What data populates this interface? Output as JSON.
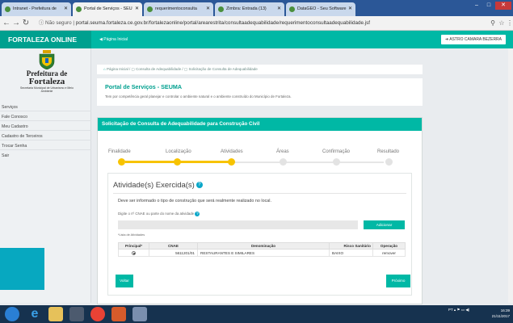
{
  "browser": {
    "tabs": [
      {
        "label": "Intranet - Prefeitura de"
      },
      {
        "label": "Portal de Serviços - SEU"
      },
      {
        "label": "requerimentoconsulta"
      },
      {
        "label": "Zimbra: Entrada (13)"
      },
      {
        "label": "DataGEO - Seu Software"
      }
    ],
    "url_security": "Não seguro",
    "url": "portal.seuma.fortaleza.ce.gov.br/fortalezaonline/portal/arearestrita/consultaadequabilidade/requerimentoconsultaadequabilidade.jsf"
  },
  "header": {
    "brand": "FORTALEZA ONLINE",
    "breadcrumb": "Página Inicial",
    "user_button": "ASTRO CAMARA BEZERRA"
  },
  "sidebar": {
    "logo": {
      "line1": "Prefeitura de",
      "line2": "Fortaleza",
      "line3": "Secretaria Municipal de Urbanismo e Meio Ambiente"
    },
    "items": [
      {
        "label": "Serviços"
      },
      {
        "label": "Fale Conosco"
      },
      {
        "label": "Meu Cadastro"
      },
      {
        "label": "Cadastro de Terceiros"
      },
      {
        "label": "Trocar Senha"
      },
      {
        "label": "Sair"
      }
    ]
  },
  "breadcrumb_card": {
    "home": "Página Inicial",
    "sep1": "/",
    "item1": "Consulta de Adequabilidade",
    "sep2": "/",
    "item2": "Solicitação de Consulta de Adequabilidade"
  },
  "intro": {
    "title": "Portal de Serviços - SEUMA",
    "description": "Tem por competência geral planejar e controlar o ambiente natural e o ambiente construído do Município de Fortaleza."
  },
  "panel": {
    "title": "Solicitação de Consulta de Adequabilidade para Construção Civil",
    "steps": [
      "Finalidade",
      "Localização",
      "Atividades",
      "Áreas",
      "Confirmação",
      "Resultado"
    ],
    "current_step": 3,
    "activity_title": "Atividade(s) Exercida(s)",
    "help_glyph": "?",
    "instruction": "Deve ser informado o tipo de construção que será realmente realizado no local.",
    "cnae_label": "Digite o nº CNAE ou parte do nome da atividade",
    "cnae_value": "",
    "add_button": "Adicionar",
    "list_label": "*Lista de Atividades",
    "table": {
      "headers": [
        "Principal*",
        "CNAE",
        "Denominação",
        "Risco Sanitário",
        "Operação"
      ],
      "rows": [
        {
          "cnae": "5611201/01",
          "denominacao": "RESTAURANTES E SIMILARES",
          "risco": "BAIXO",
          "operacao": "remover"
        }
      ]
    },
    "back_button": "Voltar",
    "next_button": "Próximo"
  },
  "taskbar": {
    "tray": "PT",
    "time": "16:39",
    "date": "21/11/2017"
  },
  "colors": {
    "accent": "#00b8a5",
    "brand_dark": "#00a08f",
    "step_active": "#f7c300",
    "taskbar": "#16324f"
  }
}
